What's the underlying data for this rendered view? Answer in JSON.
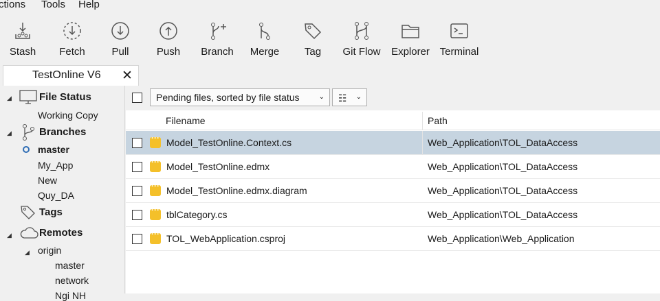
{
  "menu": [
    "ctions",
    "Tools",
    "Help"
  ],
  "toolbar": [
    {
      "label": "Stash",
      "icon": "stash-icon"
    },
    {
      "label": "Fetch",
      "icon": "fetch-icon"
    },
    {
      "label": "Pull",
      "icon": "pull-icon"
    },
    {
      "label": "Push",
      "icon": "push-icon"
    },
    {
      "label": "Branch",
      "icon": "branch-icon"
    },
    {
      "label": "Merge",
      "icon": "merge-icon"
    },
    {
      "label": "Tag",
      "icon": "tag-icon"
    },
    {
      "label": "Git Flow",
      "icon": "git-flow-icon"
    },
    {
      "label": "Explorer",
      "icon": "folder-icon"
    },
    {
      "label": "Terminal",
      "icon": "terminal-icon"
    }
  ],
  "tab": {
    "title": "TestOnline V6",
    "close": "✕"
  },
  "sidebar": {
    "file_status": {
      "label": "File Status",
      "items": [
        "Working Copy"
      ]
    },
    "branches": {
      "label": "Branches",
      "items": [
        "master",
        "My_App",
        "New",
        "Quy_DA"
      ],
      "current": "master"
    },
    "tags": {
      "label": "Tags"
    },
    "remotes": {
      "label": "Remotes",
      "origin": {
        "label": "origin",
        "items": [
          "master",
          "network",
          "Ngi NH"
        ]
      }
    }
  },
  "filter": {
    "combo_label": "Pending files, sorted by file status",
    "view_icon": "list-view-icon"
  },
  "columns": {
    "filename": "Filename",
    "path": "Path"
  },
  "files": [
    {
      "name": "Model_TestOnline.Context.cs",
      "path": "Web_Application\\TOL_DataAccess",
      "selected": true
    },
    {
      "name": "Model_TestOnline.edmx",
      "path": "Web_Application\\TOL_DataAccess",
      "selected": false
    },
    {
      "name": "Model_TestOnline.edmx.diagram",
      "path": "Web_Application\\TOL_DataAccess",
      "selected": false
    },
    {
      "name": "tblCategory.cs",
      "path": "Web_Application\\TOL_DataAccess",
      "selected": false
    },
    {
      "name": "TOL_WebApplication.csproj",
      "path": "Web_Application\\Web_Application",
      "selected": false
    }
  ],
  "colors": {
    "selected_row": "#c6d4e0",
    "file_badge": "#f4c02a",
    "current_branch_ring": "#2f6db5"
  }
}
